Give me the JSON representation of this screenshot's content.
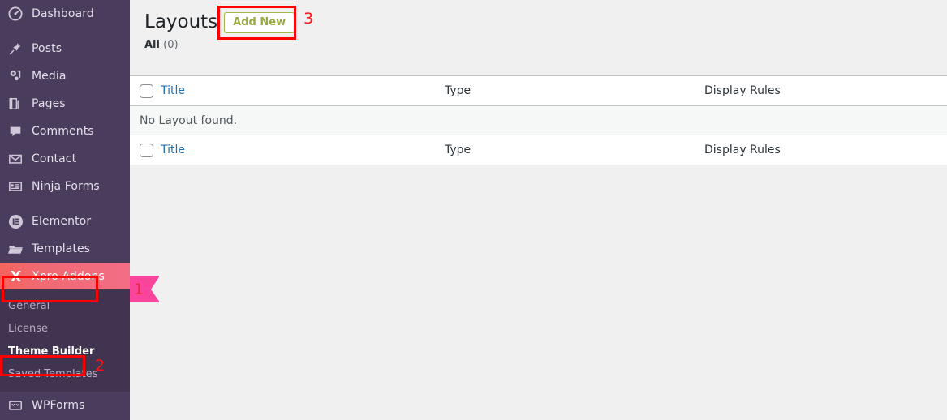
{
  "sidebar": {
    "items": [
      {
        "label": "Dashboard",
        "icon": "dashboard-icon",
        "name": "dashboard"
      },
      {
        "label": "Posts",
        "icon": "pin-icon",
        "name": "posts"
      },
      {
        "label": "Media",
        "icon": "media-icon",
        "name": "media"
      },
      {
        "label": "Pages",
        "icon": "pages-icon",
        "name": "pages"
      },
      {
        "label": "Comments",
        "icon": "comment-icon",
        "name": "comments"
      },
      {
        "label": "Contact",
        "icon": "envelope-icon",
        "name": "contact"
      },
      {
        "label": "Ninja Forms",
        "icon": "forms-icon",
        "name": "ninja-forms"
      },
      {
        "label": "Elementor",
        "icon": "elementor-icon",
        "name": "elementor"
      },
      {
        "label": "Templates",
        "icon": "folder-icon",
        "name": "templates"
      },
      {
        "label": "Xpro Addons",
        "icon": "xpro-x-icon",
        "name": "xpro-addons"
      },
      {
        "label": "WPForms",
        "icon": "wpforms-icon",
        "name": "wpforms"
      }
    ],
    "submenu": [
      {
        "label": "General",
        "name": "general"
      },
      {
        "label": "License",
        "name": "license"
      },
      {
        "label": "Theme Builder",
        "name": "theme-builder"
      },
      {
        "label": "Saved Templates",
        "name": "saved-templates"
      }
    ],
    "colors": {
      "background": "#4a3c5c",
      "submenu_background": "#413450",
      "active_gradient_start": "#f4645f",
      "active_gradient_end": "#f36d86",
      "flag_pink": "#f9469c"
    }
  },
  "annotations": {
    "one": "1",
    "two": "2",
    "three": "3",
    "color": "#ff0000"
  },
  "main": {
    "page_title": "Layouts",
    "add_new_label": "Add New",
    "add_new_color": "#a3b745",
    "filters": {
      "all_label": "All",
      "all_count": "(0)"
    },
    "table": {
      "columns": [
        {
          "label": "Title",
          "type": "link"
        },
        {
          "label": "Type",
          "type": "plain"
        },
        {
          "label": "Display Rules",
          "type": "plain"
        }
      ],
      "empty_message": "No Layout found."
    }
  }
}
